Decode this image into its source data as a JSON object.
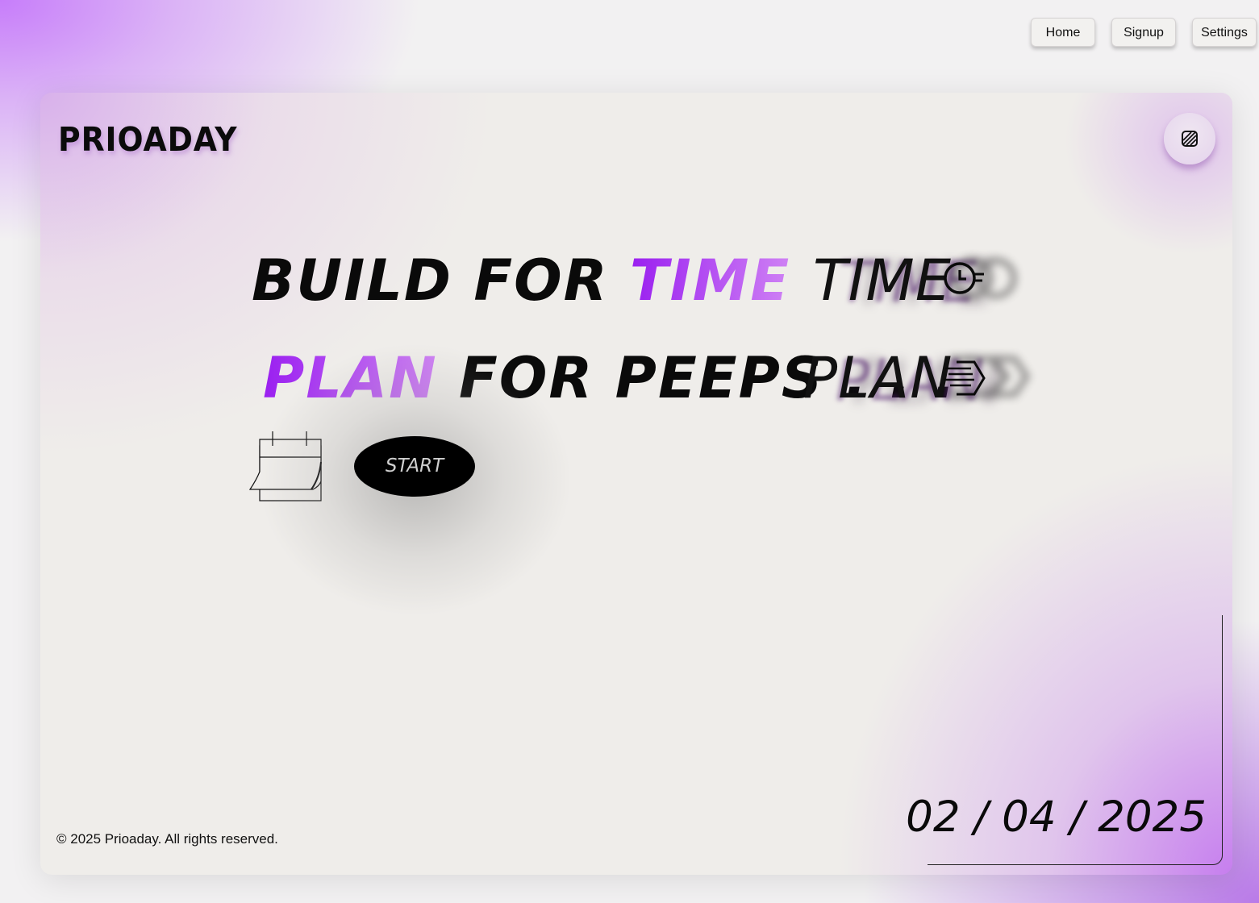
{
  "nav": {
    "items": [
      {
        "label": "Home"
      },
      {
        "label": "Signup"
      },
      {
        "label": "Settings"
      }
    ]
  },
  "brand": {
    "name": "PRIOADAY"
  },
  "theme_toggle": {
    "icon": "hatched-square-icon"
  },
  "hero": {
    "line1": {
      "text_before": "BUILD FOR ",
      "accent": "TIME"
    },
    "line2": {
      "accent": "PLAN",
      "text_after": " FOR PEEPS . . ."
    },
    "ghost_words": [
      {
        "word": "TIME",
        "icon": "clock-list-icon"
      },
      {
        "word": "PLAN",
        "icon": "speed-lines-tag-icon"
      }
    ],
    "accent_colors": [
      "#9a1ff0",
      "#cf82f4"
    ]
  },
  "calendar": {
    "icon": "calendar-icon"
  },
  "start_button": {
    "label": "START"
  },
  "footer": {
    "copyright": "© 2025 Prioaday. All rights reserved."
  },
  "date_display": {
    "value": "02 / 04 / 2025"
  },
  "colors": {
    "background_light": "#f2f1f2",
    "gradient_purple": "#c77dfa",
    "card_bg": "#efedea",
    "text_dark": "#0a0a0a",
    "button_black": "#000000"
  }
}
